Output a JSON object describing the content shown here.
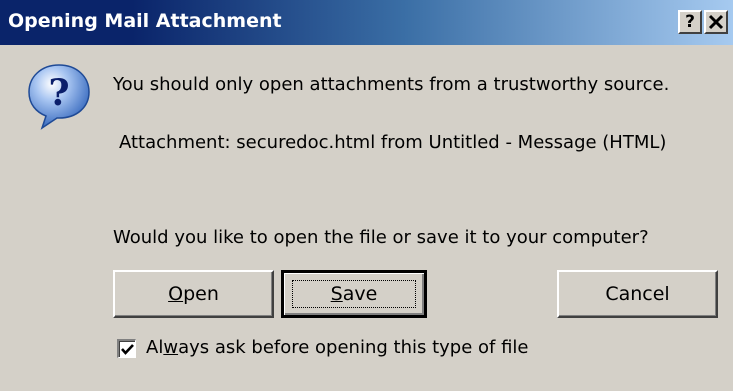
{
  "window": {
    "title": "Opening Mail Attachment",
    "help_button": "?",
    "close_button": "✕"
  },
  "icon": "question-icon",
  "message": {
    "line1": "You should only open attachments from a trustworthy source.",
    "attachment": "Attachment: securedoc.html from Untitled - Message (HTML)",
    "question": "Would you like to open the file or save it to your computer?"
  },
  "buttons": {
    "open": {
      "mnemonic": "O",
      "rest": "pen"
    },
    "save": {
      "mnemonic": "S",
      "rest": "ave"
    },
    "cancel": "Cancel"
  },
  "checkbox": {
    "checked": true,
    "label_pre": "Al",
    "label_mnemonic": "w",
    "label_post": "ays ask before opening this type of file"
  },
  "colors": {
    "titlebar_start": "#0a246a",
    "titlebar_end": "#a6caf0",
    "face": "#d4d0c8"
  }
}
